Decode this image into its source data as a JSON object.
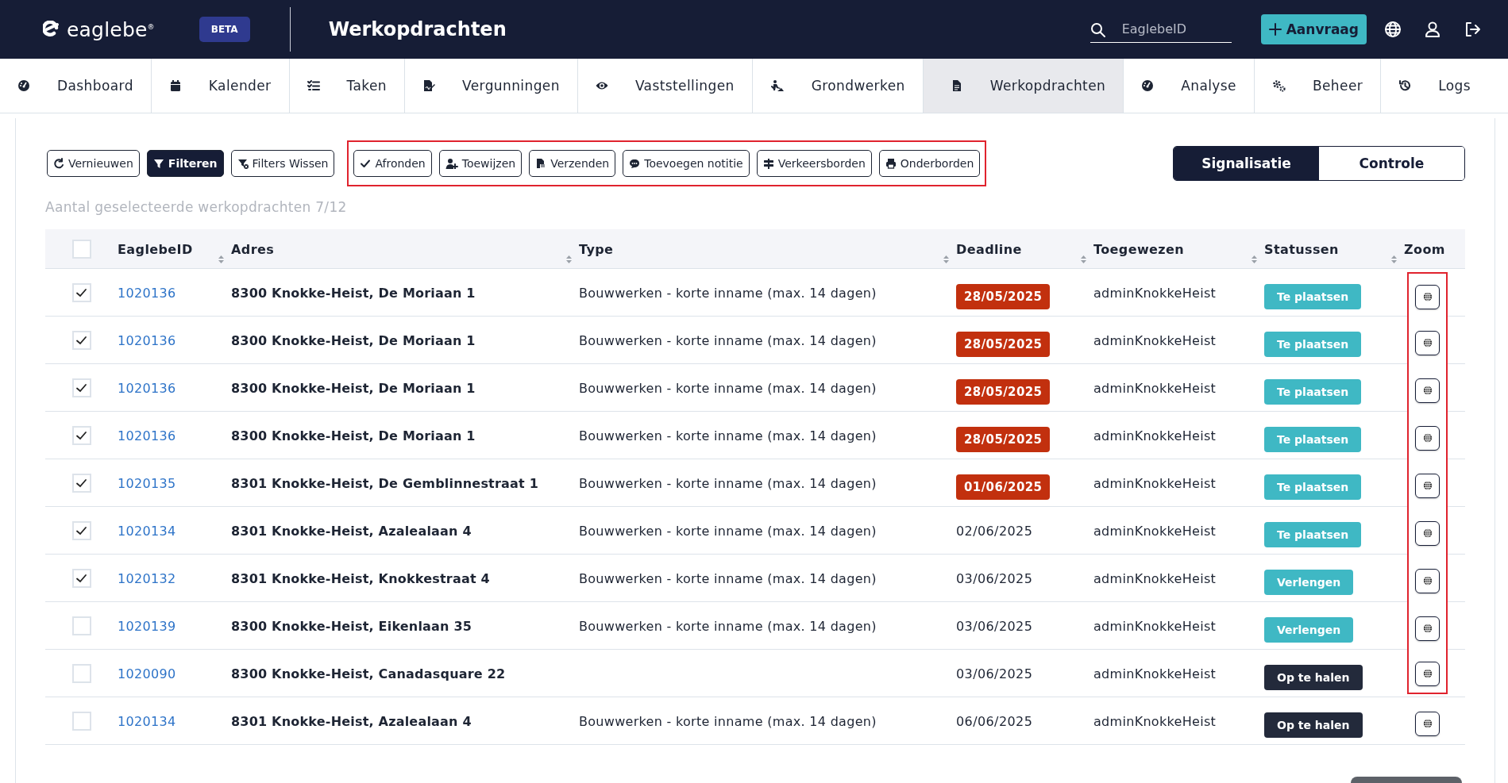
{
  "header": {
    "logo_text": "eaglebe",
    "logo_mark": "®",
    "badge": "BETA",
    "page_title": "Werkopdrachten",
    "search": {
      "placeholder": "EaglebeID"
    },
    "request_button": "Aanvraag"
  },
  "nav_tabs": [
    {
      "label": "Dashboard",
      "selected": false
    },
    {
      "label": "Kalender",
      "selected": false
    },
    {
      "label": "Taken",
      "selected": false
    },
    {
      "label": "Vergunningen",
      "selected": false
    },
    {
      "label": "Vaststellingen",
      "selected": false
    },
    {
      "label": "Grondwerken",
      "selected": false
    },
    {
      "label": "Werkopdrachten",
      "selected": true
    },
    {
      "label": "Analyse",
      "selected": false
    },
    {
      "label": "Beheer",
      "selected": false
    },
    {
      "label": "Logs",
      "selected": false
    }
  ],
  "toolbar": {
    "groups": [
      {
        "highlighted": false,
        "buttons": [
          {
            "label": "Vernieuwen",
            "primary": false
          },
          {
            "label": "Filteren",
            "primary": true
          },
          {
            "label": "Filters Wissen",
            "primary": false
          }
        ]
      },
      {
        "highlighted": true,
        "buttons": [
          {
            "label": "Afronden",
            "primary": false
          },
          {
            "label": "Toewijzen",
            "primary": false
          },
          {
            "label": "Verzenden",
            "primary": false
          },
          {
            "label": "Toevoegen notitie",
            "primary": false
          },
          {
            "label": "Verkeersborden",
            "primary": false
          },
          {
            "label": "Onderborden",
            "primary": false
          }
        ]
      }
    ]
  },
  "view_switch": [
    {
      "label": "Signalisatie",
      "selected": true
    },
    {
      "label": "Controle",
      "selected": false
    }
  ],
  "selection_count": "Aantal geselecteerde werkopdrachten 7/12",
  "table": {
    "select_all_checked": false,
    "columns": [
      {
        "label": "EaglebeID",
        "sortable": true
      },
      {
        "label": "Adres",
        "sortable": true
      },
      {
        "label": "Type",
        "sortable": true
      },
      {
        "label": "Deadline",
        "sortable": true
      },
      {
        "label": "Toegewezen",
        "sortable": true
      },
      {
        "label": "Statussen",
        "sortable": true
      },
      {
        "label": "Zoom",
        "sortable": false
      }
    ],
    "rows": [
      {
        "checked": true,
        "id": "1020136",
        "address": "8300 Knokke-Heist, De Moriaan 1",
        "type": "Bouwwerken - korte inname (max. 14 dagen)",
        "deadline": {
          "text": "28/05/2025",
          "overdue": true
        },
        "assigned": "adminKnokkeHeist",
        "status": {
          "label": "Te plaatsen",
          "color": "#3fb8c4"
        },
        "zoom_highlighted": true
      },
      {
        "checked": true,
        "id": "1020136",
        "address": "8300 Knokke-Heist, De Moriaan 1",
        "type": "Bouwwerken - korte inname (max. 14 dagen)",
        "deadline": {
          "text": "28/05/2025",
          "overdue": true
        },
        "assigned": "adminKnokkeHeist",
        "status": {
          "label": "Te plaatsen",
          "color": "#3fb8c4"
        },
        "zoom_highlighted": true
      },
      {
        "checked": true,
        "id": "1020136",
        "address": "8300 Knokke-Heist, De Moriaan 1",
        "type": "Bouwwerken - korte inname (max. 14 dagen)",
        "deadline": {
          "text": "28/05/2025",
          "overdue": true
        },
        "assigned": "adminKnokkeHeist",
        "status": {
          "label": "Te plaatsen",
          "color": "#3fb8c4"
        },
        "zoom_highlighted": true
      },
      {
        "checked": true,
        "id": "1020136",
        "address": "8300 Knokke-Heist, De Moriaan 1",
        "type": "Bouwwerken - korte inname (max. 14 dagen)",
        "deadline": {
          "text": "28/05/2025",
          "overdue": true
        },
        "assigned": "adminKnokkeHeist",
        "status": {
          "label": "Te plaatsen",
          "color": "#3fb8c4"
        },
        "zoom_highlighted": true
      },
      {
        "checked": true,
        "id": "1020135",
        "address": "8301 Knokke-Heist, De Gemblinnestraat 1",
        "type": "Bouwwerken - korte inname (max. 14 dagen)",
        "deadline": {
          "text": "01/06/2025",
          "overdue": true
        },
        "assigned": "adminKnokkeHeist",
        "status": {
          "label": "Te plaatsen",
          "color": "#3fb8c4"
        },
        "zoom_highlighted": true
      },
      {
        "checked": true,
        "id": "1020134",
        "address": "8301 Knokke-Heist, Azalealaan 4",
        "type": "Bouwwerken - korte inname (max. 14 dagen)",
        "deadline": {
          "text": "02/06/2025",
          "overdue": false
        },
        "assigned": "adminKnokkeHeist",
        "status": {
          "label": "Te plaatsen",
          "color": "#3fb8c4"
        },
        "zoom_highlighted": true
      },
      {
        "checked": true,
        "id": "1020132",
        "address": "8301 Knokke-Heist, Knokkestraat 4",
        "type": "Bouwwerken - korte inname (max. 14 dagen)",
        "deadline": {
          "text": "03/06/2025",
          "overdue": false
        },
        "assigned": "adminKnokkeHeist",
        "status": {
          "label": "Verlengen",
          "color": "#3fb8c4"
        },
        "zoom_highlighted": true
      },
      {
        "checked": false,
        "id": "1020139",
        "address": "8300 Knokke-Heist, Eikenlaan 35",
        "type": "Bouwwerken - korte inname (max. 14 dagen)",
        "deadline": {
          "text": "03/06/2025",
          "overdue": false
        },
        "assigned": "adminKnokkeHeist",
        "status": {
          "label": "Verlengen",
          "color": "#3fb8c4"
        },
        "zoom_highlighted": true
      },
      {
        "checked": false,
        "id": "1020090",
        "address": "8300 Knokke-Heist, Canadasquare 22",
        "deadline": {
          "text": "03/06/2025",
          "overdue": false
        },
        "assigned": "adminKnokkeHeist",
        "status": {
          "label": "Op te halen",
          "color": "#232a3b"
        },
        "zoom_highlighted": true
      },
      {
        "checked": false,
        "id": "1020134",
        "address": "8301 Knokke-Heist, Azalealaan 4",
        "type": "Bouwwerken - korte inname (max. 14 dagen)",
        "deadline": {
          "text": "06/06/2025",
          "overdue": false
        },
        "assigned": "adminKnokkeHeist",
        "status": {
          "label": "Op te halen",
          "color": "#232a3b"
        },
        "zoom_highlighted": false
      }
    ]
  }
}
